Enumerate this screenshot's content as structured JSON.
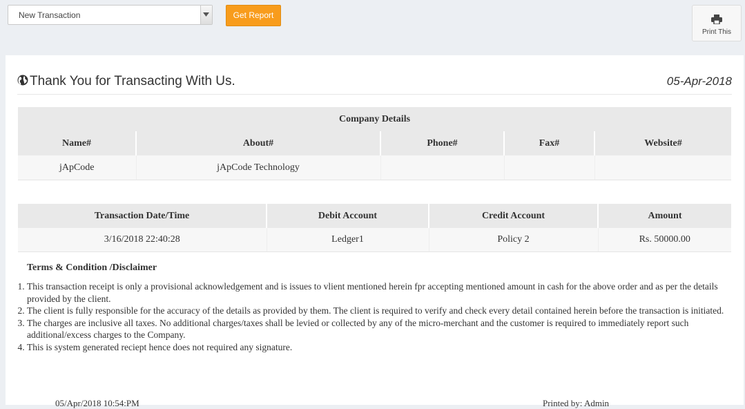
{
  "toolbar": {
    "select_value": "New Transaction",
    "report_button": "Get Report",
    "print_button": "Print This",
    "accent_color": "#f89c1c"
  },
  "receipt": {
    "title": "Thank You for Transacting With Us.",
    "date": "05-Apr-2018",
    "title_icon": "globe-icon"
  },
  "company": {
    "caption": "Company Details",
    "headers": [
      "Name#",
      "About#",
      "Phone#",
      "Fax#",
      "Website#"
    ],
    "values": [
      "jApCode",
      "jApCode Technology",
      "",
      "",
      ""
    ]
  },
  "transaction": {
    "headers": [
      "Transaction Date/Time",
      "Debit Account",
      "Credit Account",
      "Amount"
    ],
    "values": [
      "3/16/2018 22:40:28",
      "Ledger1",
      "Policy 2",
      "Rs. 50000.00"
    ]
  },
  "terms": {
    "title": "Terms & Condition /Disclaimer",
    "items": [
      "This transaction receipt is only a provisional acknowledgement and is issues to vlient mentioned herein fpr accepting mentioned amount in cash for the above order and as per the details provided by the client.",
      "The client is fully responsible for the accuracy of the details as provided by them. The client is required to verify and check every detail contained herein before the transaction is initiated.",
      "The charges are inclusive all taxes. No additional charges/taxes shall be levied or collected by any of the micro-merchant and the customer is required to immediately report such additional/excess charges to the Company.",
      "This is system generated reciept hence does not required any signature."
    ]
  },
  "footer": {
    "printed_on": "05/Apr/2018 10:54:PM",
    "printed_by": "Printed by: Admin"
  }
}
